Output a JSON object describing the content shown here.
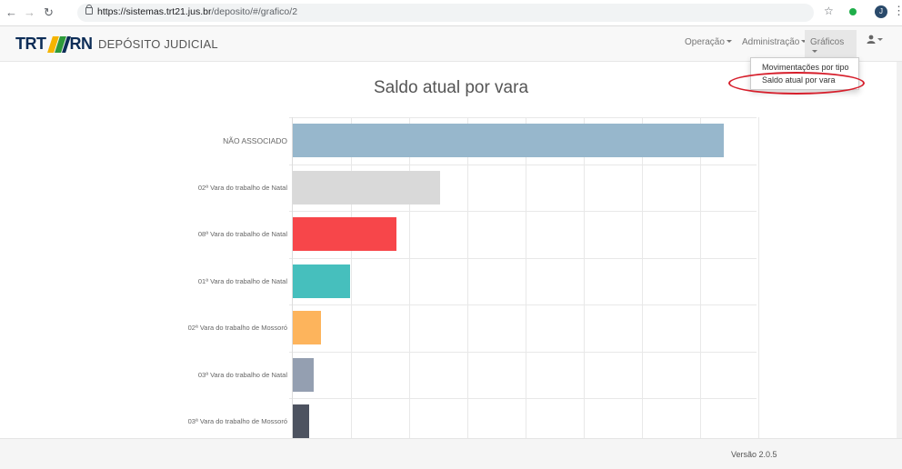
{
  "browser": {
    "url_host": "https://sistemas.trt21.jus.br",
    "url_path": "/deposito/#/grafico/2",
    "back_icon": "arrow-left",
    "forward_icon": "arrow-right",
    "reload_icon": "reload",
    "profile_initial": "J"
  },
  "navbar": {
    "logo_left": "TRT",
    "logo_right": "RN",
    "brand": "DEPÓSITO JUDICIAL",
    "menus": [
      {
        "label": "Operação"
      },
      {
        "label": "Administração"
      },
      {
        "label": "Gráficos"
      }
    ],
    "user_icon": "user-icon"
  },
  "dropdown": {
    "items": [
      {
        "label": "Movimentações por tipo"
      },
      {
        "label": "Saldo atual por vara"
      }
    ]
  },
  "chart_data": {
    "type": "bar",
    "orientation": "horizontal",
    "title": "Saldo atual por vara",
    "categories": [
      "NÃO ASSOCIADO",
      "02ª Vara do trabalho de Natal",
      "08ª Vara do trabalho de Natal",
      "01ª Vara do trabalho de Natal",
      "02ª Vara do trabalho de Mossoró",
      "03ª Vara do trabalho de Natal",
      "03ª Vara do trabalho de Mossoró"
    ],
    "values": [
      474,
      162,
      114,
      63,
      31,
      23,
      18
    ],
    "colors": [
      "#97b7cc",
      "#d9d9d9",
      "#f7464a",
      "#46bfbd",
      "#fdb45c",
      "#949fb1",
      "#4d5360"
    ],
    "xlim": [
      0,
      510
    ],
    "grid": true
  },
  "footer": {
    "version": "Versão 2.0.5"
  }
}
